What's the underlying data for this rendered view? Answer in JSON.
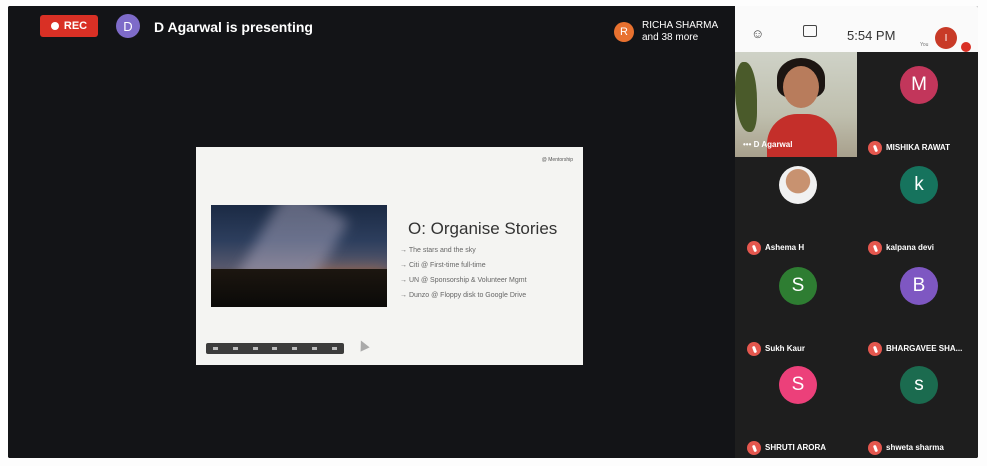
{
  "recording": {
    "label": "REC"
  },
  "presenter": {
    "initial": "D",
    "text": "D Agarwal is presenting"
  },
  "participants_bar": {
    "initial": "R",
    "name": "RICHA SHARMA",
    "more": "and 38 more"
  },
  "clock": {
    "time": "5:54 PM"
  },
  "self": {
    "label": "You",
    "initial": "I"
  },
  "slide": {
    "brand": "@ Mentorship",
    "title": "O: Organise Stories",
    "bullets": [
      "→ The stars and the sky",
      "→ Citi @ First-time full-time",
      "→ UN @ Sponsorship & Volunteer Mgmt",
      "→ Dunzo @ Floppy disk to Google Drive"
    ]
  },
  "featured": {
    "name": "D Agarwal"
  },
  "tiles": [
    {
      "name": "MISHIKA RAWAT",
      "initial": "M",
      "color": "#c2365b"
    },
    {
      "name": "Ashema H",
      "initial": "",
      "color": "#e0d4c8"
    },
    {
      "name": "kalpana devi",
      "initial": "k",
      "color": "#16735d"
    },
    {
      "name": "Sukh Kaur",
      "initial": "S",
      "color": "#2e7d32"
    },
    {
      "name": "BHARGAVEE SHA...",
      "initial": "B",
      "color": "#7e57c2"
    },
    {
      "name": "SHRUTI ARORA",
      "initial": "S",
      "color": "#ec407a"
    },
    {
      "name": "shweta sharma",
      "initial": "s",
      "color": "#1b6b4f"
    }
  ]
}
